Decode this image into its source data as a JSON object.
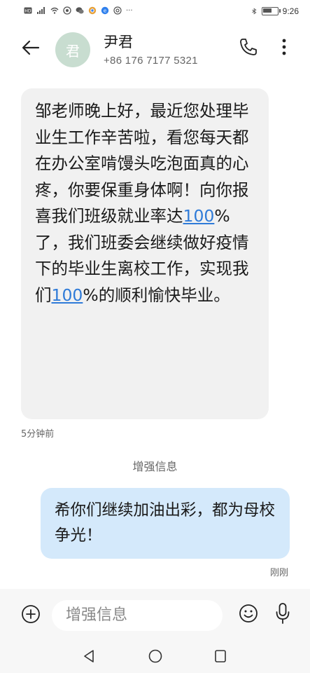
{
  "status_bar": {
    "left_icons": [
      "hd-icon",
      "signal-4g-icon",
      "wifi-icon",
      "app-icon",
      "wechat-icon",
      "chrome-icon",
      "app2-icon",
      "camera-icon"
    ],
    "more_dots": "···",
    "time": "9:26"
  },
  "header": {
    "avatar_char": "君",
    "contact_name": "尹君",
    "contact_phone": "+86 176 7177 5321"
  },
  "messages": {
    "incoming": {
      "parts": [
        "邹老师晚上好，最近您处理毕业生工作辛苦啦，看您每天都在办公室啃馒头吃泡面真的心疼，你要保重身体啊！向你报喜我们班级就业率达",
        "100",
        "%了，我们班委会继续做好疫情下的毕业生离校工作，实现我们",
        "100",
        "%的顺利愉快毕业。"
      ],
      "time": "5分钟前"
    },
    "divider": "增强信息",
    "outgoing": {
      "text": "希你们继续加油出彩，都为母校争光！",
      "time": "刚刚"
    }
  },
  "composer": {
    "placeholder": "增强信息"
  },
  "colors": {
    "incoming_bubble": "#f1f1f1",
    "outgoing_bubble": "#d4e9fb",
    "link": "#2f7bd8",
    "avatar": "#c8ddd0"
  }
}
